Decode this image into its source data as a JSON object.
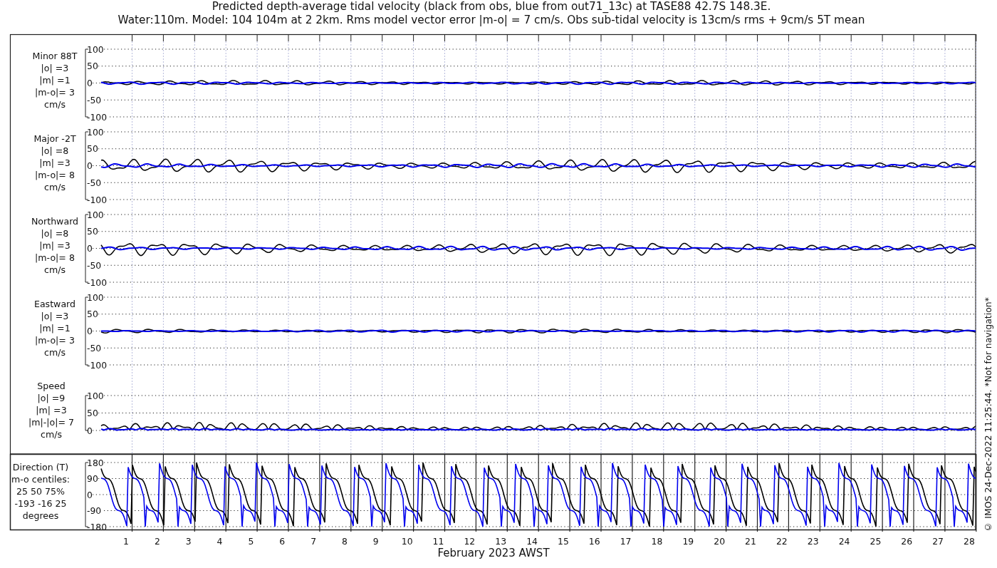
{
  "title": {
    "line_1": "Predicted depth-average tidal velocity (black from obs, blue from out71_13c) at TASE88 42.7S 148.3E.",
    "line_2": "Water:110m. Model: 104 104m at 2 2km. Rms model vector error |m-o| = 7 cm/s. Obs sub-tidal velocity is 13cm/s rms + 9cm/s 5T mean"
  },
  "panels": [
    {
      "kind": "velocity",
      "label_lines": [
        "Minor 88T",
        "|o| =3",
        "|m| =1",
        "|m-o|= 3",
        "cm/s"
      ],
      "yticks": [
        "100",
        "50",
        "0",
        "-50",
        "-100"
      ]
    },
    {
      "kind": "velocity",
      "label_lines": [
        "Major -2T",
        "|o| =8",
        "|m| =3",
        "|m-o|= 8",
        "cm/s"
      ],
      "yticks": [
        "100",
        "50",
        "0",
        "-50",
        "-100"
      ]
    },
    {
      "kind": "velocity",
      "label_lines": [
        "Northward",
        "|o| =8",
        "|m| =3",
        "|m-o|= 8",
        "cm/s"
      ],
      "yticks": [
        "100",
        "50",
        "0",
        "-50",
        "-100"
      ]
    },
    {
      "kind": "velocity",
      "label_lines": [
        "Eastward",
        "|o| =3",
        "|m| =1",
        "|m-o|= 3",
        "cm/s"
      ],
      "yticks": [
        "100",
        "50",
        "0",
        "-50",
        "-100"
      ]
    },
    {
      "kind": "speed",
      "label_lines": [
        "Speed",
        "|o| =9",
        "|m| =3",
        "|m|-|o|= 7",
        "cm/s"
      ],
      "yticks": [
        "100",
        "50",
        "0"
      ]
    },
    {
      "kind": "direction",
      "label_lines": [
        "Direction (T)",
        "m-o centiles:",
        "25 50 75%",
        "-193 -16 25",
        "degrees"
      ],
      "yticks": [
        "180",
        "90",
        "0",
        "-90",
        "-180"
      ]
    }
  ],
  "xticks": [
    "1",
    "2",
    "3",
    "4",
    "5",
    "6",
    "7",
    "8",
    "9",
    "10",
    "11",
    "12",
    "13",
    "14",
    "15",
    "16",
    "17",
    "18",
    "19",
    "20",
    "21",
    "22",
    "23",
    "24",
    "25",
    "26",
    "27",
    "28"
  ],
  "xlabel": "February 2023 AWST",
  "footer_note": "© IMOS 24-Dec-2022 11:25:44. *Not for navigation*"
}
